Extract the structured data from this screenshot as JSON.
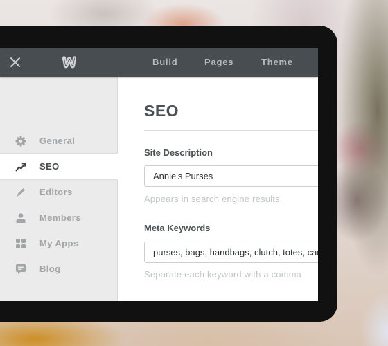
{
  "topbar": {
    "close_icon": "close-icon",
    "logo_icon": "weebly-w-logo",
    "nav": [
      {
        "label": "Build"
      },
      {
        "label": "Pages"
      },
      {
        "label": "Theme"
      }
    ]
  },
  "sidebar": {
    "active": "SEO",
    "items": [
      {
        "label": "General",
        "icon": "gear-icon"
      },
      {
        "label": "SEO",
        "icon": "trend-line-icon"
      },
      {
        "label": "Editors",
        "icon": "pencil-icon"
      },
      {
        "label": "Members",
        "icon": "person-icon"
      },
      {
        "label": "My Apps",
        "icon": "grid-icon"
      },
      {
        "label": "Blog",
        "icon": "speech-bubble-icon"
      }
    ]
  },
  "content": {
    "title": "SEO",
    "fields": [
      {
        "label": "Site Description",
        "value": "Annie's Purses",
        "help": "Appears in search engine results"
      },
      {
        "label": "Meta Keywords",
        "value": "purses, bags, handbags, clutch, totes, carryalls",
        "help": "Separate each keyword with a comma"
      }
    ]
  },
  "colors": {
    "topbar": "#474d51",
    "sidebar": "#ebebeb",
    "device_frame": "#111111",
    "active_text": "#4a4f52",
    "inactive_text": "#a3a6a8"
  }
}
